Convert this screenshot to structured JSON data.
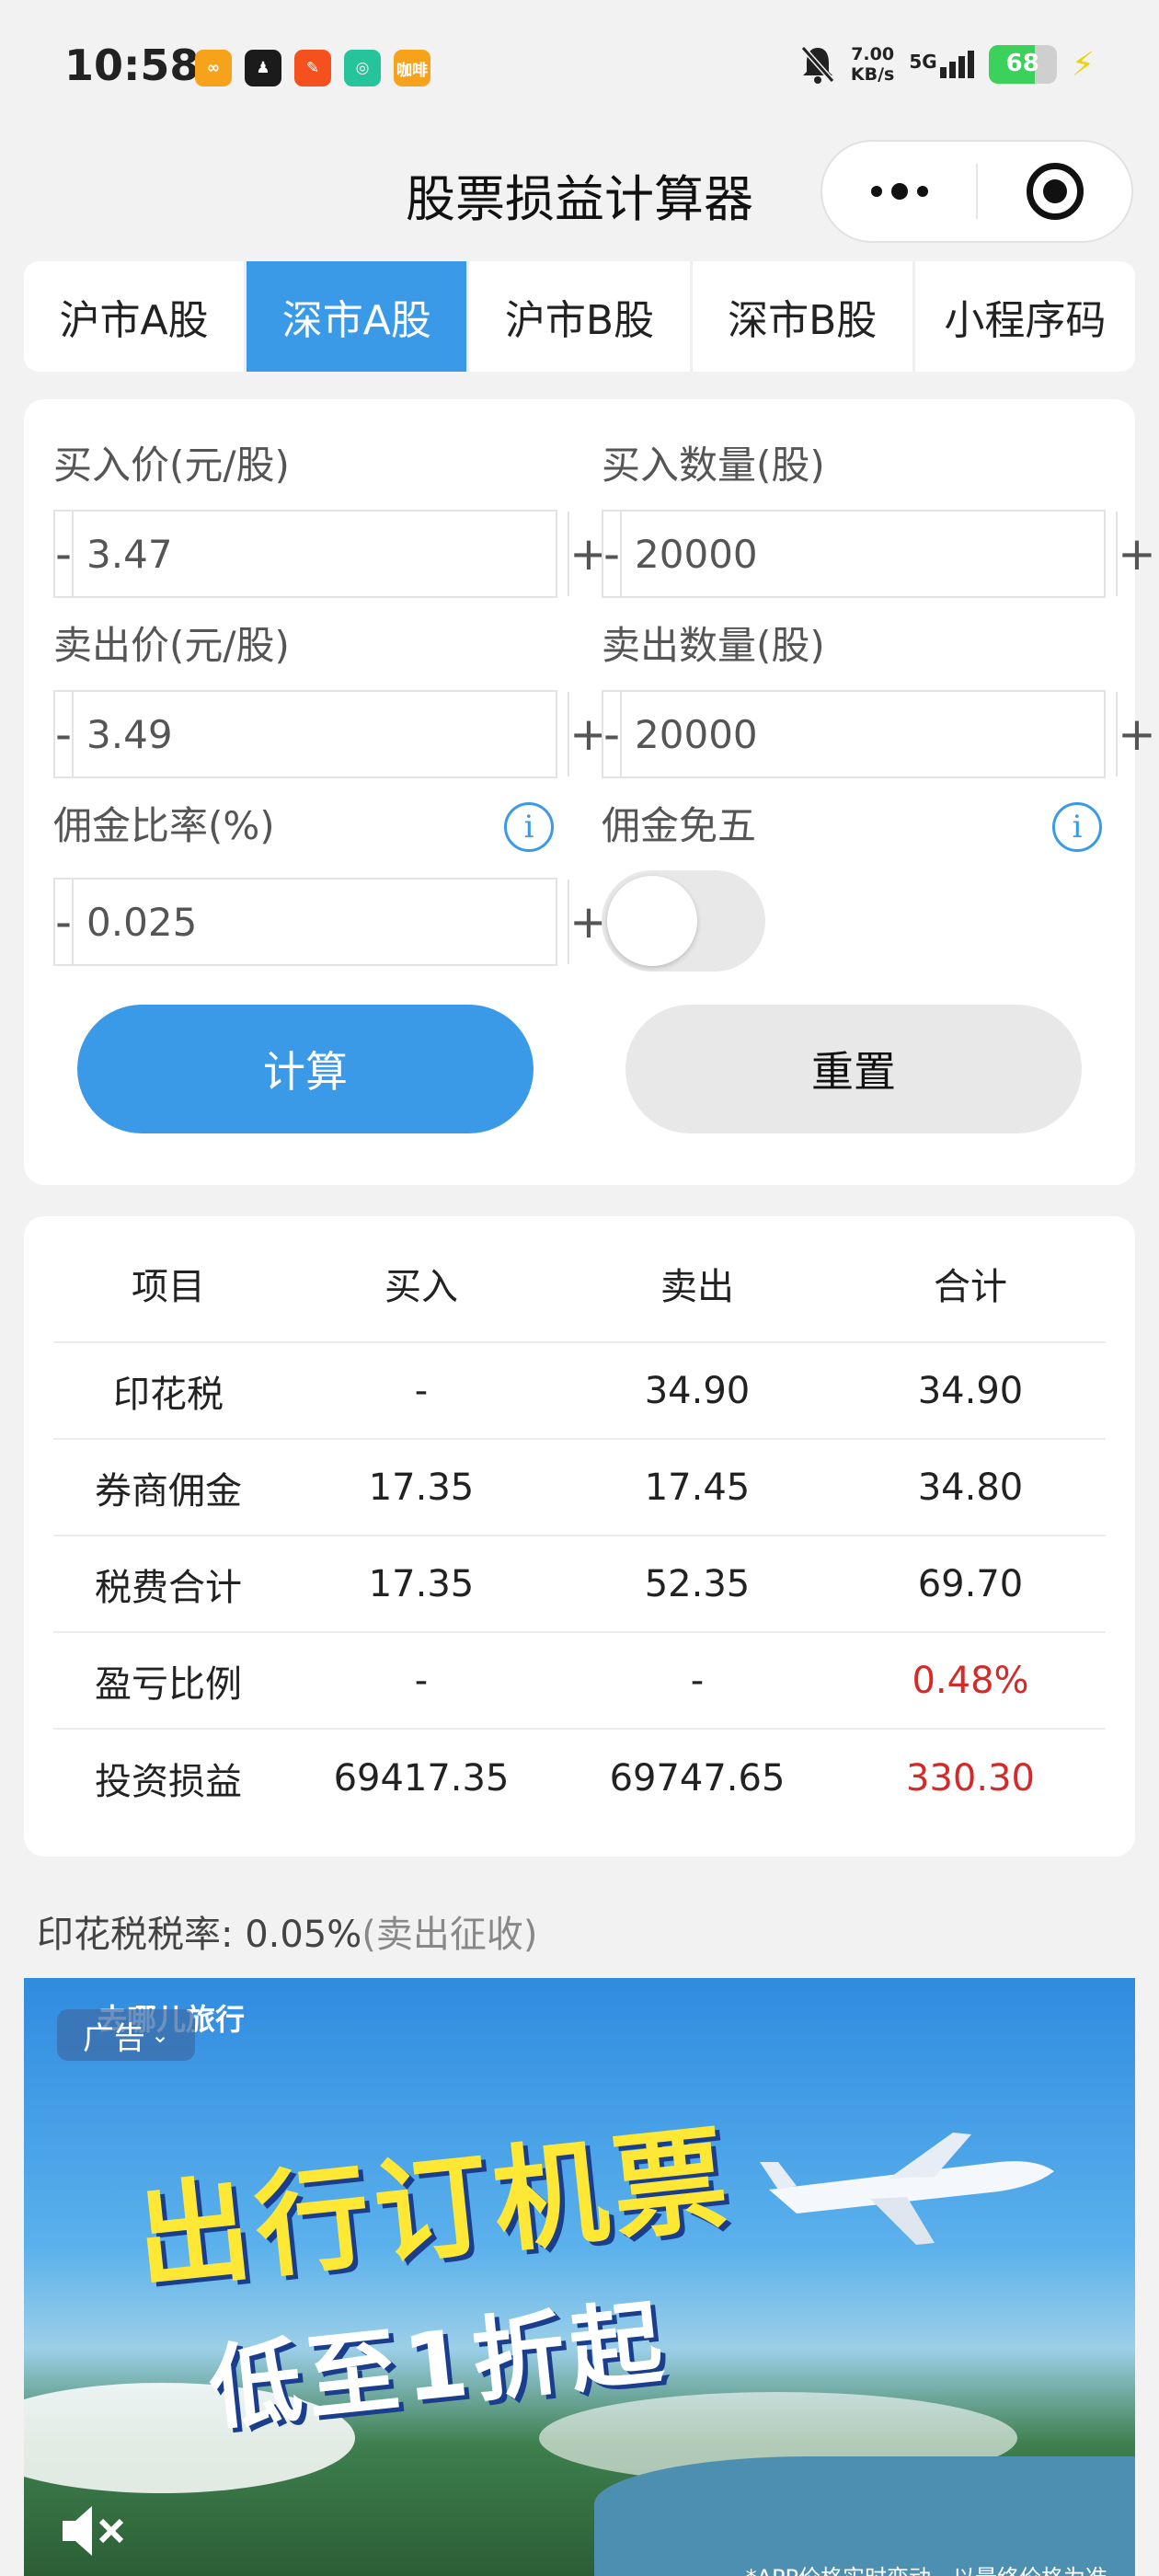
{
  "status_bar": {
    "time": "10:58",
    "app_icons": [
      {
        "icon": "app-orange-icon",
        "color": "#f7a21b",
        "text": "∞"
      },
      {
        "icon": "app-black-icon",
        "color": "#1b1b1b",
        "text": "♟"
      },
      {
        "icon": "app-red-icon",
        "color": "#f4511e",
        "text": "✎"
      },
      {
        "icon": "app-green-icon",
        "color": "#27c39a",
        "text": "◎"
      },
      {
        "icon": "app-yellow-icon",
        "color": "#f7a21b",
        "text": "咖啡"
      }
    ],
    "speed_value": "7.00",
    "speed_unit": "KB/s",
    "network": "5G",
    "battery": "68",
    "battery_level": 0.68
  },
  "nav": {
    "title": "股票损益计算器"
  },
  "tabs": [
    {
      "label": "沪市A股",
      "active": false
    },
    {
      "label": "深市A股",
      "active": true
    },
    {
      "label": "沪市B股",
      "active": false
    },
    {
      "label": "深市B股",
      "active": false
    },
    {
      "label": "小程序码",
      "active": false
    }
  ],
  "form": {
    "buy_price_label": "买入价(元/股)",
    "buy_price_value": "3.47",
    "buy_qty_label": "买入数量(股)",
    "buy_qty_value": "20000",
    "sell_price_label": "卖出价(元/股)",
    "sell_price_value": "3.49",
    "sell_qty_label": "卖出数量(股)",
    "sell_qty_value": "20000",
    "commission_rate_label": "佣金比率(%)",
    "commission_rate_value": "0.025",
    "commission_free_label": "佣金免五",
    "commission_free_on": false,
    "minus": "-",
    "plus": "+",
    "info": "i",
    "calc_button": "计算",
    "reset_button": "重置"
  },
  "results": {
    "headers": [
      "项目",
      "买入",
      "卖出",
      "合计"
    ],
    "rows": [
      {
        "item": "印花税",
        "buy": "-",
        "sell": "34.90",
        "total": "34.90",
        "total_red": false
      },
      {
        "item": "券商佣金",
        "buy": "17.35",
        "sell": "17.45",
        "total": "34.80",
        "total_red": false
      },
      {
        "item": "税费合计",
        "buy": "17.35",
        "sell": "52.35",
        "total": "69.70",
        "total_red": false
      },
      {
        "item": "盈亏比例",
        "buy": "-",
        "sell": "-",
        "total": "0.48%",
        "total_red": true
      },
      {
        "item": "投资损益",
        "buy": "69417.35",
        "sell": "69747.65",
        "total": "330.30",
        "total_red": true
      }
    ]
  },
  "tax_note": {
    "label": "印花税税率: 0.05%",
    "suffix": "(卖出征收)"
  },
  "ad": {
    "brand": "去哪儿旅行",
    "badge": "广告",
    "headline1": "出行订机票",
    "headline2": "低至1折起",
    "footnote": "*APP价格实时变动，以最终价格为准"
  },
  "colors": {
    "accent": "#3a9ae8",
    "loss_profit": "#d42a2a"
  }
}
